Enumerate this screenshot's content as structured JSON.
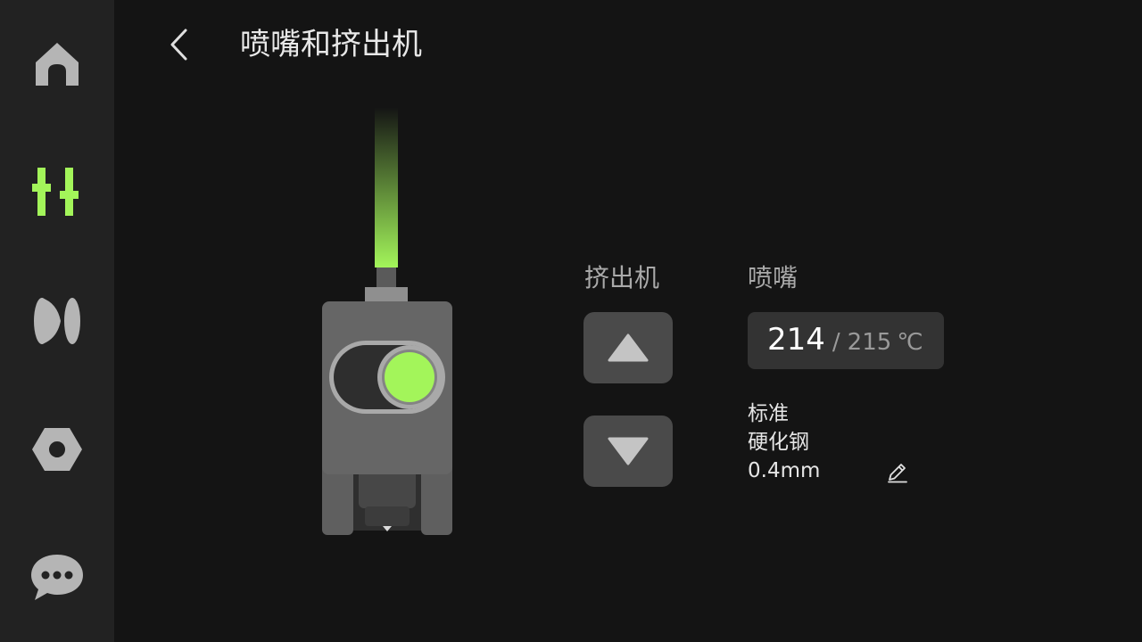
{
  "colors": {
    "accent": "#a3f55a",
    "sidebar_bg": "#222222",
    "page_bg": "#141414",
    "icon_inactive": "#b5b5b5",
    "button_bg": "#4a4a4a"
  },
  "sidebar": {
    "items": [
      {
        "icon": "home-icon",
        "active": false
      },
      {
        "icon": "sliders-icon",
        "active": true
      },
      {
        "icon": "filament-spool-icon",
        "active": false
      },
      {
        "icon": "hex-nut-settings-icon",
        "active": false
      },
      {
        "icon": "chat-bubble-icon",
        "active": false
      }
    ]
  },
  "header": {
    "back_icon": "chevron-left-icon",
    "title": "喷嘴和挤出机"
  },
  "extruder": {
    "label": "挤出机",
    "up_icon": "triangle-up-icon",
    "down_icon": "triangle-down-icon"
  },
  "nozzle": {
    "label": "喷嘴",
    "temp_current": "214",
    "temp_separator": "/",
    "temp_target": "215",
    "temp_unit": "℃",
    "type": "标准",
    "material": "硬化钢",
    "diameter": "0.4mm",
    "edit_icon": "pencil-edit-icon"
  }
}
